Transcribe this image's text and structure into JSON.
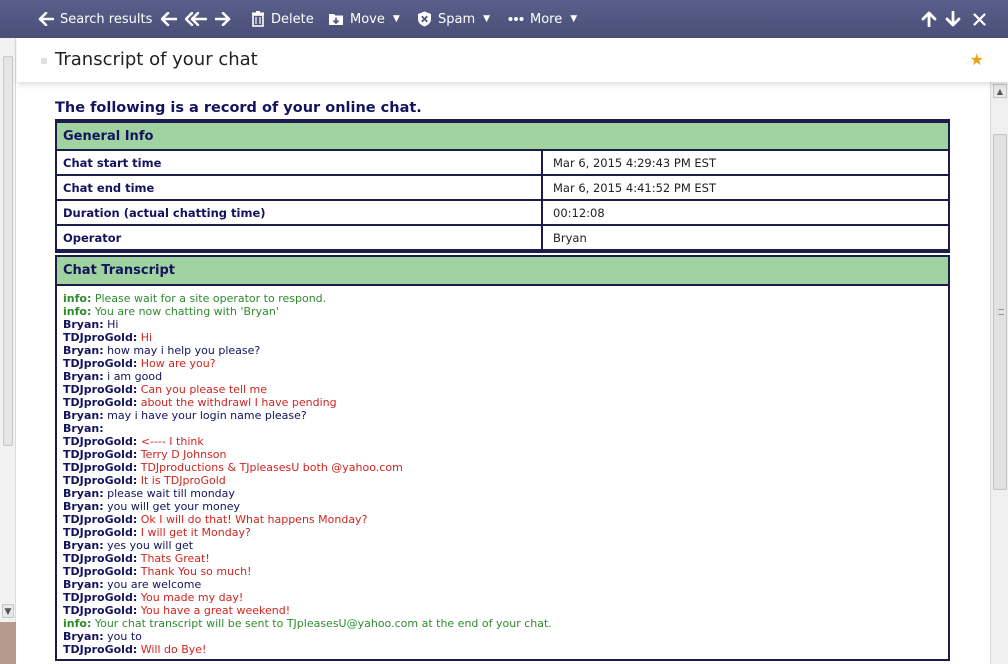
{
  "toolbar": {
    "search_results": "Search results",
    "delete": "Delete",
    "move": "Move",
    "spam": "Spam",
    "more": "More"
  },
  "subject": {
    "title": "Transcript of your chat"
  },
  "message": {
    "lead": "The following is a record of your online chat.",
    "general_info": {
      "header": "General Info",
      "rows": [
        {
          "label": "Chat start time",
          "value": "Mar 6, 2015 4:29:43 PM EST"
        },
        {
          "label": "Chat end time",
          "value": "Mar 6, 2015 4:41:52 PM EST"
        },
        {
          "label": "Duration (actual chatting time)",
          "value": "00:12:08"
        },
        {
          "label": "Operator",
          "value": "Bryan"
        }
      ]
    },
    "transcript": {
      "header": "Chat Transcript",
      "lines": [
        {
          "speaker": "info:",
          "text": "Please wait for a site operator to respond.",
          "kind": "info"
        },
        {
          "speaker": "info:",
          "text": "You are now chatting with 'Bryan'",
          "kind": "info"
        },
        {
          "speaker": "Bryan:",
          "text": "Hi",
          "kind": "bryan"
        },
        {
          "speaker": "TDJproGold:",
          "text": "Hi",
          "kind": "tdj"
        },
        {
          "speaker": "Bryan:",
          "text": "how may i help you please?",
          "kind": "bryan"
        },
        {
          "speaker": "TDJproGold:",
          "text": "How are you?",
          "kind": "tdj"
        },
        {
          "speaker": "Bryan:",
          "text": "i am good",
          "kind": "bryan"
        },
        {
          "speaker": "TDJproGold:",
          "text": "Can you please tell me",
          "kind": "tdj"
        },
        {
          "speaker": "TDJproGold:",
          "text": "about the withdrawl I have pending",
          "kind": "tdj"
        },
        {
          "speaker": "Bryan:",
          "text": "may i have your login name please?",
          "kind": "bryan"
        },
        {
          "speaker": "Bryan:",
          "text": "",
          "kind": "bryan"
        },
        {
          "speaker": "TDJproGold:",
          "text": "<---- I think",
          "kind": "tdj"
        },
        {
          "speaker": "TDJproGold:",
          "text": "Terry D Johnson",
          "kind": "tdj"
        },
        {
          "speaker": "TDJproGold:",
          "text": "TDJproductions & TJpleasesU both @yahoo.com",
          "kind": "tdj"
        },
        {
          "speaker": "TDJproGold:",
          "text": "It is TDJproGold",
          "kind": "tdj"
        },
        {
          "speaker": "Bryan:",
          "text": "please wait till monday",
          "kind": "bryan"
        },
        {
          "speaker": "Bryan:",
          "text": "you will get your money",
          "kind": "bryan"
        },
        {
          "speaker": "TDJproGold:",
          "text": "Ok I will do that! What happens Monday?",
          "kind": "tdj"
        },
        {
          "speaker": "TDJproGold:",
          "text": "I will get it Monday?",
          "kind": "tdj"
        },
        {
          "speaker": "Bryan:",
          "text": "yes you will get",
          "kind": "bryan"
        },
        {
          "speaker": "TDJproGold:",
          "text": "Thats Great!",
          "kind": "tdj"
        },
        {
          "speaker": "TDJproGold:",
          "text": "Thank You so much!",
          "kind": "tdj"
        },
        {
          "speaker": "Bryan:",
          "text": "you are welcome",
          "kind": "bryan"
        },
        {
          "speaker": "TDJproGold:",
          "text": "You made my day!",
          "kind": "tdj"
        },
        {
          "speaker": "TDJproGold:",
          "text": "You have a great weekend!",
          "kind": "tdj"
        },
        {
          "speaker": "info:",
          "text": "Your chat transcript will be sent to TJpleasesU@yahoo.com at the end of your chat.",
          "kind": "info"
        },
        {
          "speaker": "Bryan:",
          "text": "you to",
          "kind": "bryan"
        },
        {
          "speaker": "TDJproGold:",
          "text": "Will do Bye!",
          "kind": "tdj"
        }
      ]
    }
  },
  "colors": {
    "toolbar_bg": "#4f547f",
    "header_green": "#a0d3a0",
    "navy_text": "#13135e",
    "operator_text": "#13135e",
    "customer_text": "#d0241f",
    "info_text": "#2e8b2e",
    "star": "#e8a317"
  }
}
